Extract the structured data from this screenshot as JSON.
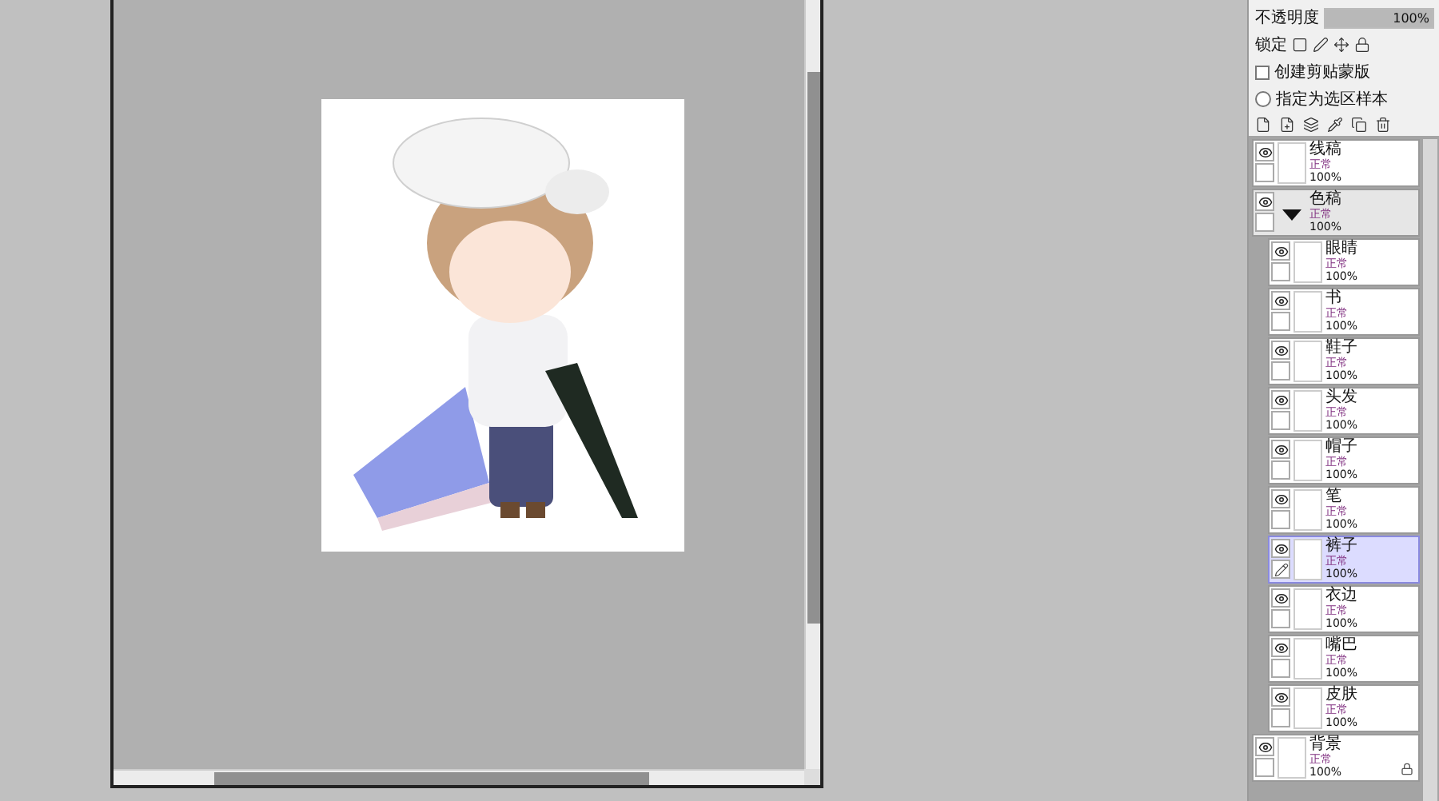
{
  "layer_panel": {
    "opacity": {
      "label": "不透明度",
      "value": "100%",
      "level": 1
    },
    "lock": {
      "label": "锁定"
    },
    "clipping_mask": {
      "label": "创建剪贴蒙版",
      "checked": false
    },
    "selection_sample": {
      "label": "指定为选区样本",
      "selected": false
    }
  },
  "layers": [
    {
      "kind": "layer",
      "name": "线稿",
      "mode": "正常",
      "opacity": "100%",
      "visible": true,
      "selected": false,
      "locked": false
    },
    {
      "kind": "folder",
      "name": "色稿",
      "mode": "正常",
      "opacity": "100%",
      "visible": true,
      "selected": false,
      "expanded": true,
      "children": [
        {
          "kind": "layer",
          "name": "眼睛",
          "mode": "正常",
          "opacity": "100%",
          "visible": true,
          "selected": false,
          "locked": false
        },
        {
          "kind": "layer",
          "name": "书",
          "mode": "正常",
          "opacity": "100%",
          "visible": true,
          "selected": false,
          "locked": false
        },
        {
          "kind": "layer",
          "name": "鞋子",
          "mode": "正常",
          "opacity": "100%",
          "visible": true,
          "selected": false,
          "locked": false
        },
        {
          "kind": "layer",
          "name": "头发",
          "mode": "正常",
          "opacity": "100%",
          "visible": true,
          "selected": false,
          "locked": false
        },
        {
          "kind": "layer",
          "name": "帽子",
          "mode": "正常",
          "opacity": "100%",
          "visible": true,
          "selected": false,
          "locked": false
        },
        {
          "kind": "layer",
          "name": "笔",
          "mode": "正常",
          "opacity": "100%",
          "visible": true,
          "selected": false,
          "locked": false
        },
        {
          "kind": "layer",
          "name": "裤子",
          "mode": "正常",
          "opacity": "100%",
          "visible": true,
          "selected": true,
          "locked": false
        },
        {
          "kind": "layer",
          "name": "衣边",
          "mode": "正常",
          "opacity": "100%",
          "visible": true,
          "selected": false,
          "locked": false
        },
        {
          "kind": "layer",
          "name": "嘴巴",
          "mode": "正常",
          "opacity": "100%",
          "visible": true,
          "selected": false,
          "locked": false
        },
        {
          "kind": "layer",
          "name": "皮肤",
          "mode": "正常",
          "opacity": "100%",
          "visible": true,
          "selected": false,
          "locked": false
        }
      ]
    },
    {
      "kind": "layer",
      "name": "背景",
      "mode": "正常",
      "opacity": "100%",
      "visible": true,
      "selected": false,
      "locked": true
    }
  ]
}
